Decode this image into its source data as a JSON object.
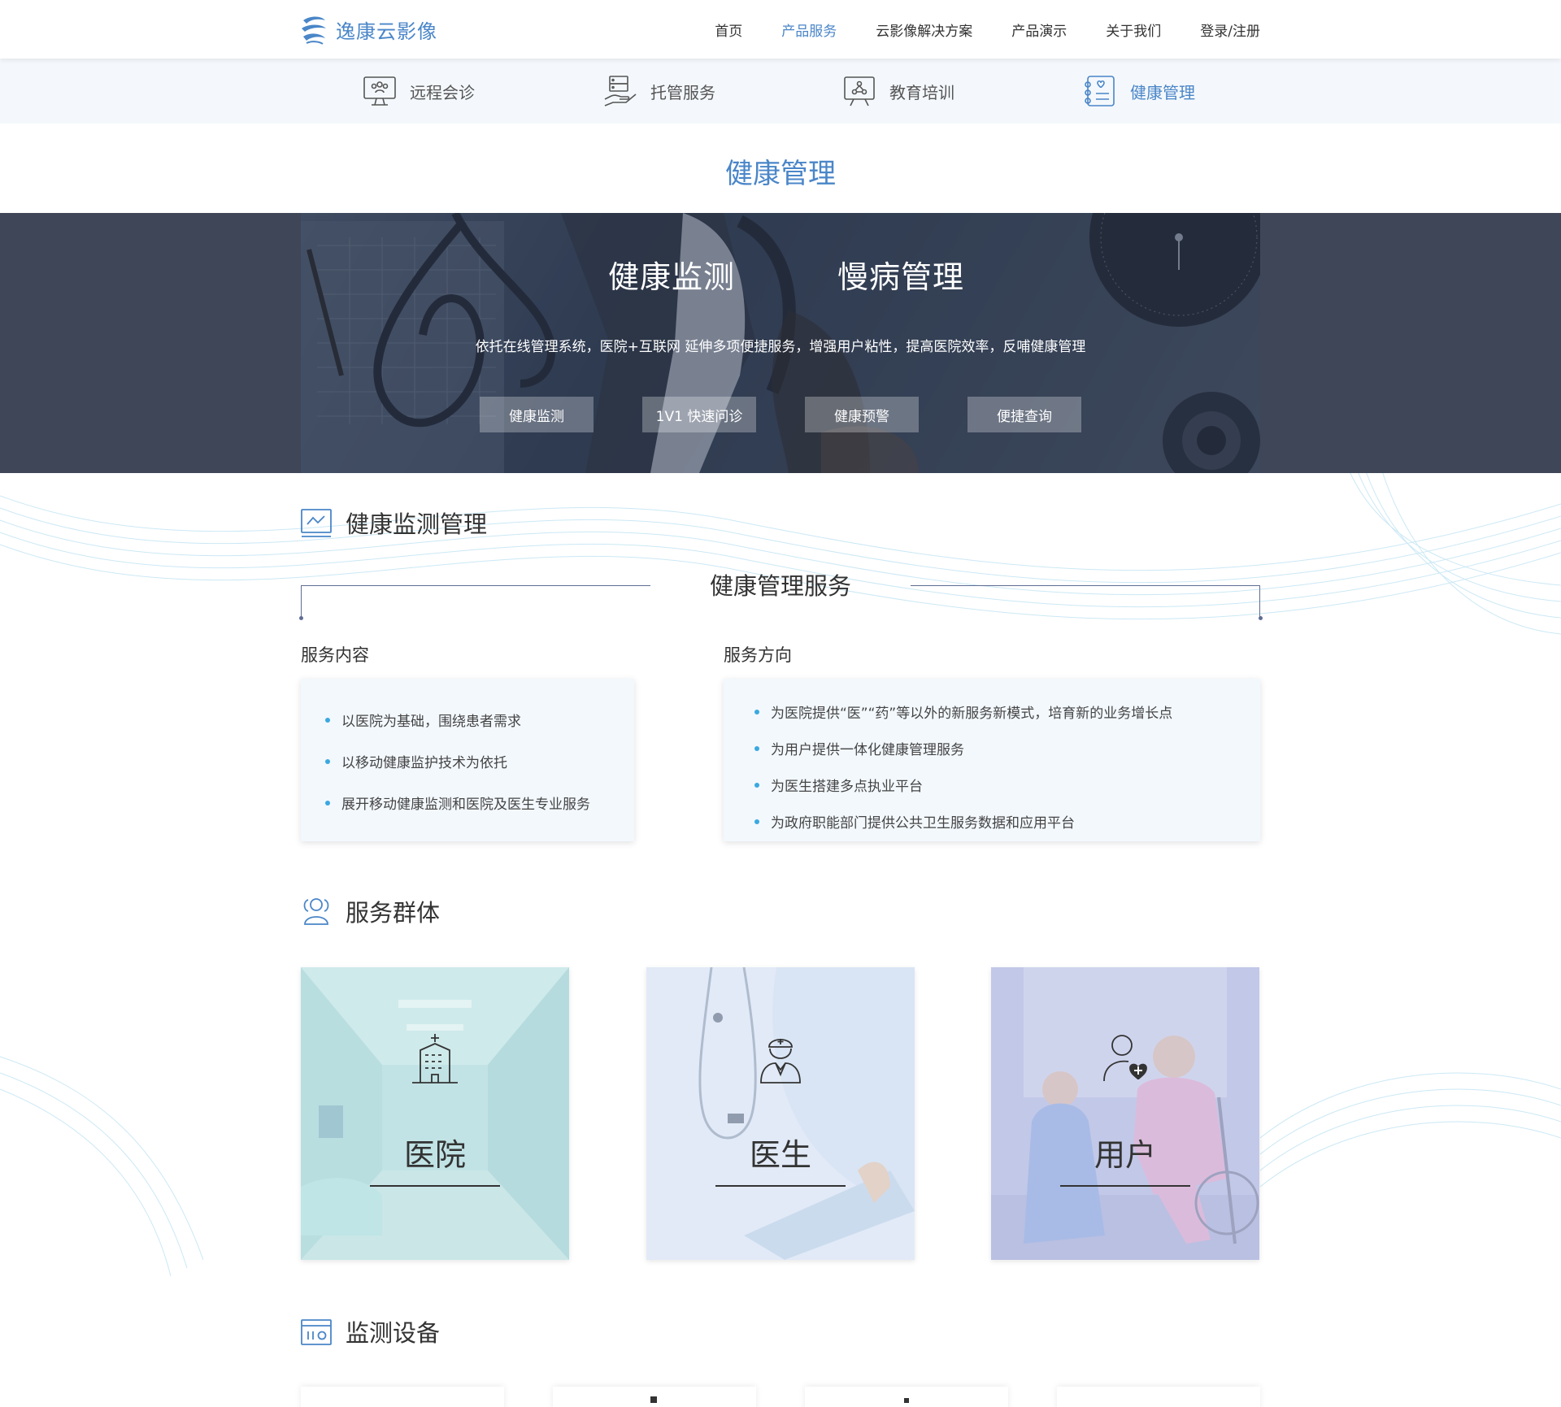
{
  "header": {
    "logo_text": "逸康云影像",
    "nav": [
      {
        "label": "首页",
        "active": false
      },
      {
        "label": "产品服务",
        "active": true
      },
      {
        "label": "云影像解决方案",
        "active": false
      },
      {
        "label": "产品演示",
        "active": false
      },
      {
        "label": "关于我们",
        "active": false
      },
      {
        "label": "登录/注册",
        "active": false
      }
    ]
  },
  "subnav": [
    {
      "label": "远程会诊",
      "icon": "monitor-group-icon",
      "active": false
    },
    {
      "label": "托管服务",
      "icon": "server-hand-icon",
      "active": false
    },
    {
      "label": "教育培训",
      "icon": "presentation-icon",
      "active": false
    },
    {
      "label": "健康管理",
      "icon": "health-list-icon",
      "active": true
    }
  ],
  "page_title": "健康管理",
  "banner": {
    "headings": [
      "健康监测",
      "慢病管理"
    ],
    "description": "依托在线管理系统，医院+互联网 延伸多项便捷服务，增强用户粘性，提高医院效率，反哺健康管理",
    "buttons": [
      "健康监测",
      "1V1 快速问诊",
      "健康预警",
      "便捷查询"
    ]
  },
  "monitor_section": {
    "title": "健康监测管理",
    "service_title": "健康管理服务",
    "content": {
      "title": "服务内容",
      "items": [
        "以医院为基础，围绕患者需求",
        "以移动健康监护技术为依托",
        "展开移动健康监测和医院及医生专业服务"
      ]
    },
    "direction": {
      "title": "服务方向",
      "items": [
        "为医院提供“医”“药”等以外的新服务新模式，培育新的业务增长点",
        "为用户提供一体化健康管理服务",
        "为医生搭建多点执业平台",
        "为政府职能部门提供公共卫生服务数据和应用平台"
      ]
    }
  },
  "groups": {
    "title": "服务群体",
    "items": [
      {
        "label": "医院",
        "icon": "hospital-building-icon"
      },
      {
        "label": "医生",
        "icon": "doctor-icon"
      },
      {
        "label": "用户",
        "icon": "user-heart-icon"
      }
    ]
  },
  "devices": {
    "title": "监测设备"
  },
  "colors": {
    "accent": "#4a86c8",
    "banner_bg": "#3e4658",
    "bullet": "#3aa8e0"
  }
}
